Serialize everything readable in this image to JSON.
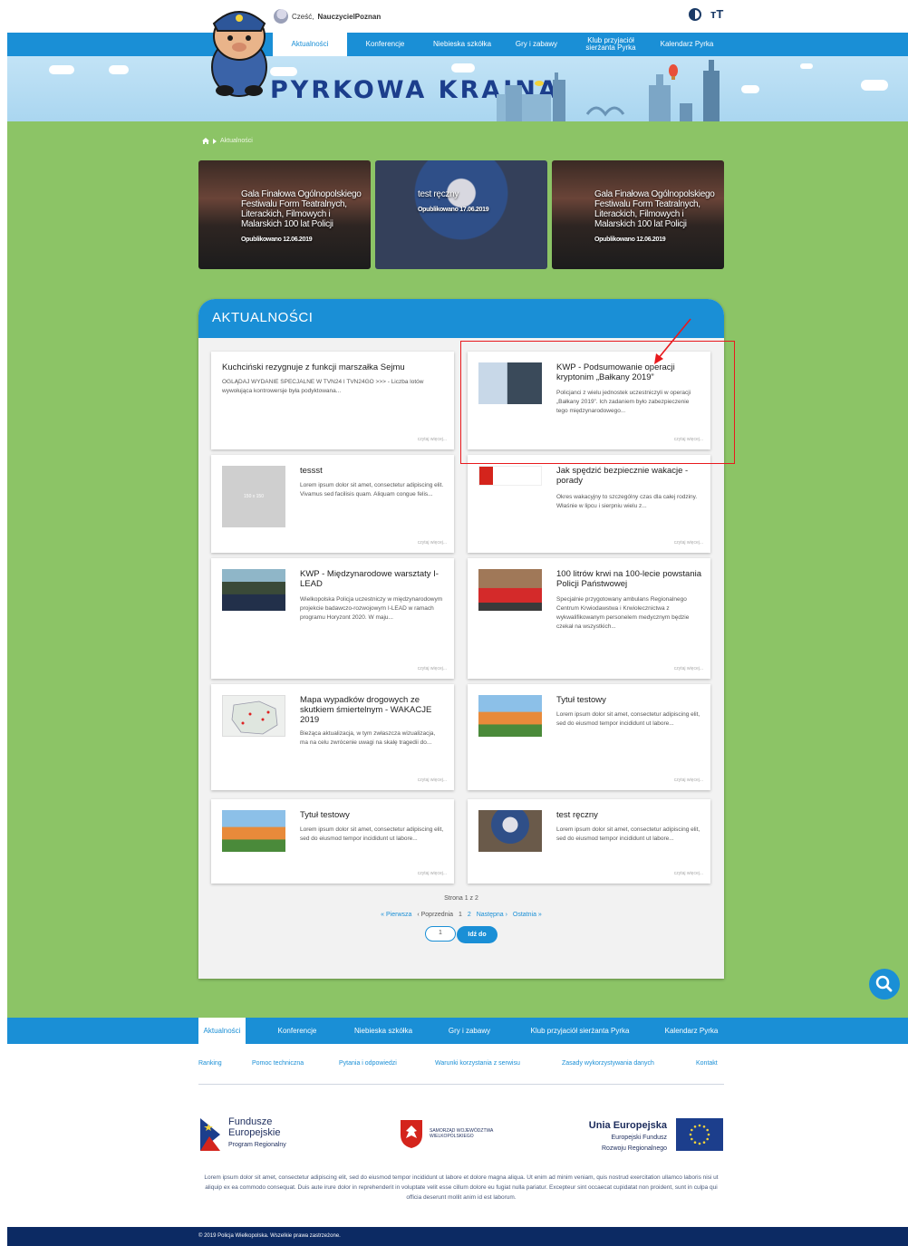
{
  "header": {
    "greeting_prefix": "Cześć,",
    "username": "NauczycielPoznan",
    "font_size_label": "тT"
  },
  "nav": {
    "items": [
      {
        "label": "Aktualności",
        "active": true
      },
      {
        "label": "Konferencje"
      },
      {
        "label": "Niebieska szkółka"
      },
      {
        "label": "Gry i zabawy"
      },
      {
        "label": "Klub przyjaciół sierżanta Pyrka"
      },
      {
        "label": "Kalendarz Pyrka"
      }
    ]
  },
  "banner": {
    "title": "PYRKOWA KRAINA"
  },
  "breadcrumb": {
    "current": "Aktualności"
  },
  "featured": [
    {
      "title": "Gala Finałowa Ogólnopolskiego Festiwalu Form Teatralnych, Literackich, Filmowych i Malarskich 100 lat Policji",
      "date": "Opublikowano 12.06.2019"
    },
    {
      "title": "test ręczny",
      "date": "Opublikowano 17.06.2019"
    },
    {
      "title": "Gala Finałowa Ogólnopolskiego Festiwalu Form Teatralnych, Literackich, Filmowych i Malarskich 100 lat Policji",
      "date": "Opublikowano 12.06.2019"
    }
  ],
  "news": {
    "heading": "AKTUALNOŚCI",
    "more_label": "czytaj więcej...",
    "placeholder_label": "150 x 150",
    "items": [
      {
        "title": "Kuchciński rezygnuje z funkcji marszałka Sejmu",
        "excerpt": "OGLĄDAJ WYDANIE SPECJALNE W TVN24 I TVN24GO >>> - Liczba lotów wywołująca kontrowersje była podyktowana..."
      },
      {
        "title": "KWP - Podsumowanie operacji kryptonim „Bałkany 2019”",
        "excerpt": "Policjanci z wielu jednostek uczestniczyli w operacji „Bałkany 2019”. Ich zadaniem było zabezpieczenie tego międzynarodowego..."
      },
      {
        "title": "tessst",
        "excerpt": "Lorem ipsum dolor sit amet, consectetur adipiscing elit. Vivamus sed facilisis quam. Aliquam congue felis..."
      },
      {
        "title": "Jak spędzić bezpiecznie wakacje - porady",
        "excerpt": "Okres wakacyjny to szczególny czas dla całej rodziny. Właśnie w lipcu i sierpniu wielu z..."
      },
      {
        "title": "KWP - Międzynarodowe warsztaty I-LEAD",
        "excerpt": "Wielkopolska Policja uczestniczy w międzynarodowym projekcie badawczo-rozwojowym I-LEAD w ramach programu Horyzont 2020. W maju..."
      },
      {
        "title": "100 litrów krwi na 100-lecie powstania Policji Państwowej",
        "excerpt": "Specjalnie przygotowany ambulans Regionalnego Centrum Krwiodawstwa i Krwiolecznictwa z wykwalifikowanym personelem medycznym będzie czekał na wszystkich..."
      },
      {
        "title": "Mapa wypadków drogowych ze skutkiem śmiertelnym - WAKACJE 2019",
        "excerpt": "Bieżąca aktualizacja, w tym zwłaszcza wizualizacja, ma na celu zwrócenie uwagi na skalę tragedii do..."
      },
      {
        "title": "Tytuł testowy",
        "excerpt": "Lorem ipsum dolor sit amet, consectetur adipiscing elit, sed do eiusmod tempor incididunt ut labore..."
      },
      {
        "title": "Tytuł testowy",
        "excerpt": "Lorem ipsum dolor sit amet, consectetur adipiscing elit, sed do eiusmod tempor incididunt ut labore..."
      },
      {
        "title": "test ręczny",
        "excerpt": "Lorem ipsum dolor sit amet, consectetur adipiscing elit, sed do eiusmod tempor incididunt ut labore..."
      }
    ]
  },
  "pagination": {
    "info": "Strona 1 z 2",
    "first": "« Pierwsza",
    "prev": "‹ Poprzednia",
    "page1": "1",
    "page2": "2",
    "next": "Następna ›",
    "last": "Ostatnia »",
    "input_value": "1",
    "go_label": "Idź do"
  },
  "footer": {
    "nav": [
      "Aktualności",
      "Konferencje",
      "Niebieska szkółka",
      "Gry i zabawy",
      "Klub przyjaciół sierżanta Pyrka",
      "Kalendarz Pyrka"
    ],
    "links": [
      "Ranking",
      "Pomoc techniczna",
      "Pytania i odpowiedzi",
      "Warunki korzystania z serwisu",
      "Zasady wykorzystywania danych",
      "Kontakt"
    ],
    "fe_logo": {
      "line1": "Fundusze",
      "line2": "Europejskie",
      "line3": "Program Regionalny"
    },
    "wlkp_logo": {
      "line1": "SAMORZĄD WOJEWÓDZTWA",
      "line2": "WIELKOPOLSKIEGO"
    },
    "eu_logo": {
      "line1": "Unia Europejska",
      "line2": "Europejski Fundusz",
      "line3": "Rozwoju Regionalnego"
    },
    "lorem": "Lorem ipsum dolor sit amet, consectetur adipiscing elit, sed do eiusmod tempor incididunt ut labore et dolore magna aliqua. Ut enim ad minim veniam, quis nostrud exercitation ullamco laboris nisi ut aliquip ex ea commodo consequat. Duis aute irure dolor in reprehenderit in voluptate velit esse cillum dolore eu fugiat nulla pariatur. Excepteur sint occaecat cupidatat non proident, sunt in culpa qui officia deserunt mollit anim id est laborum.",
    "copyright": "© 2019 Policja Wielkopolska. Wszelkie prawa zastrzeżone."
  },
  "colors": {
    "accent": "#1a8fd6",
    "background": "#8cc466",
    "navy": "#0c2a63",
    "annotation": "#e8191d"
  }
}
